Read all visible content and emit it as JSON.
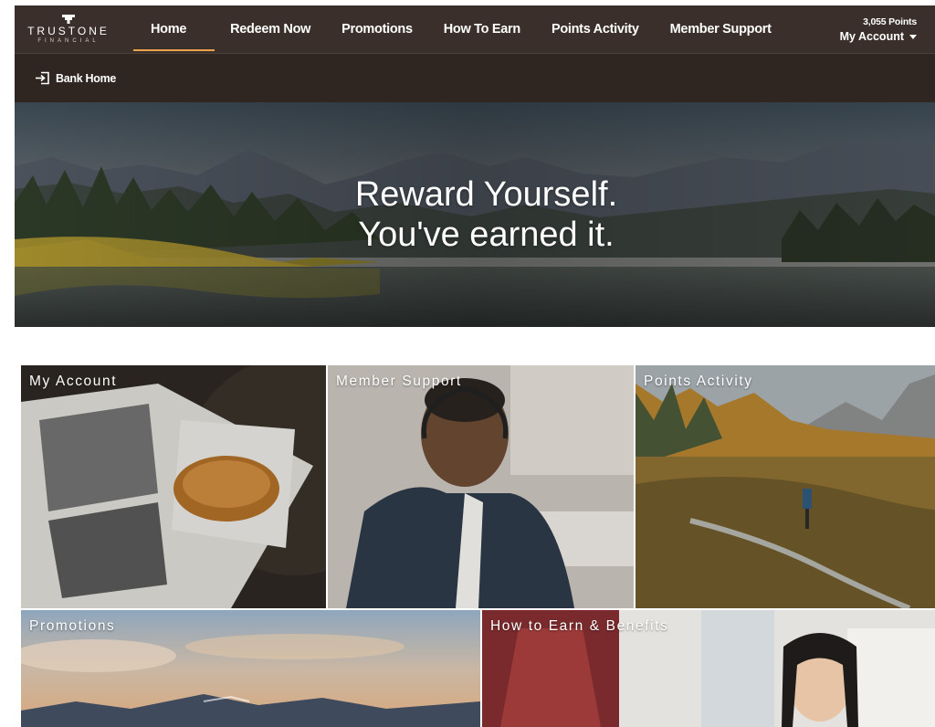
{
  "brand": {
    "name": "TRUSTONE",
    "sub": "FINANCIAL",
    "logo_icon": "trustone-logo-mark"
  },
  "nav": {
    "items": [
      {
        "label": "Home",
        "active": true
      },
      {
        "label": "Redeem Now",
        "active": false
      },
      {
        "label": "Promotions",
        "active": false
      },
      {
        "label": "How To Earn",
        "active": false
      },
      {
        "label": "Points Activity",
        "active": false
      },
      {
        "label": "Member Support",
        "active": false
      }
    ],
    "active_underline_color": "#e8a34b"
  },
  "account": {
    "points": "3,055 Points",
    "label": "My Account",
    "caret_icon": "caret-down-icon"
  },
  "subnav": {
    "bank_home_label": "Bank Home",
    "bank_home_icon": "sign-in-icon"
  },
  "hero": {
    "line1": "Reward Yourself.",
    "line2": "You've earned it."
  },
  "tiles": [
    {
      "label": "My Account"
    },
    {
      "label": "Member Support"
    },
    {
      "label": "Points Activity"
    },
    {
      "label": "Promotions"
    },
    {
      "label": "How to Earn & Benefits"
    }
  ],
  "colors": {
    "nav_bg": "#3a2f2a",
    "subnav_bg": "#2f2622",
    "accent": "#e8a34b"
  }
}
